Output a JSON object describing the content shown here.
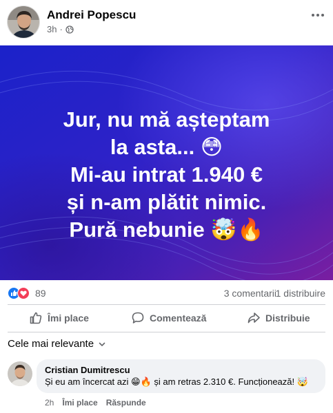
{
  "post": {
    "author": "Andrei Popescu",
    "time": "3h",
    "separator": "·",
    "privacy_icon": "globe-icon",
    "text_lines": [
      "Jur, nu mă așteptam",
      "la asta... 😳",
      "Mi-au intrat 1.940 €",
      "și n-am plătit nimic.",
      "Pură nebunie 🤯🔥"
    ],
    "background_colors": [
      "#1a1fd6",
      "#3a1fb8",
      "#7b1fa2"
    ]
  },
  "reactions": {
    "icons": [
      "like-icon",
      "love-icon"
    ],
    "count": "89",
    "comments": "3 comentarii",
    "shares": "1 distribuire"
  },
  "actions": {
    "like": "Îmi place",
    "comment": "Comentează",
    "share": "Distribuie"
  },
  "sort": {
    "label": "Cele mai relevante"
  },
  "comment": {
    "author": "Cristian Dumitrescu",
    "text": "Și eu am încercat azi 😁🔥 și am retras 2.310 €. Funcționează! 🤯",
    "time": "2h",
    "like": "Îmi place",
    "reply": "Răspunde"
  },
  "colors": {
    "secondary_text": "#65676b",
    "like_blue": "#1877f2",
    "love_red": "#f33e58",
    "bubble_bg": "#f0f2f5"
  }
}
